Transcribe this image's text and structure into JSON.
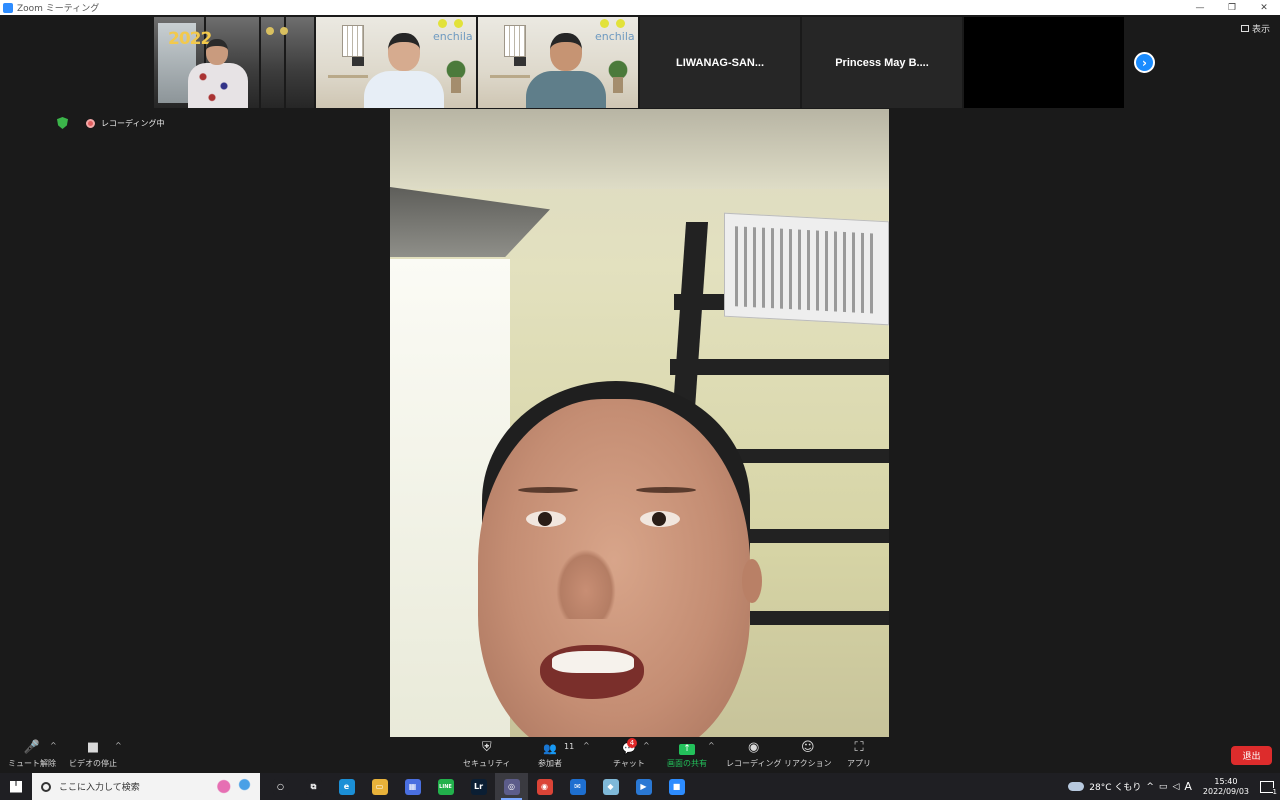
{
  "window": {
    "title": "Zoom ミーティング",
    "controls": [
      "—",
      "❐",
      "✕"
    ]
  },
  "filmstrip": {
    "tiles": [
      {
        "kind": "video",
        "overlay_text": "2022"
      },
      {
        "kind": "video",
        "overlay_text": "enchila"
      },
      {
        "kind": "video",
        "overlay_text": "enchila"
      },
      {
        "kind": "name",
        "name": "LIWANAG-SAN..."
      },
      {
        "kind": "name",
        "name": "Princess  May  B...."
      },
      {
        "kind": "blank"
      }
    ],
    "next_icon": "›"
  },
  "view_toggle": {
    "label": "表示",
    "icon": "grid-icon"
  },
  "recording": {
    "label": "レコーディング中",
    "encryption_icon": "shield-icon"
  },
  "toolbar": {
    "mute": {
      "label": "ミュート解除",
      "icon": "🎤"
    },
    "video": {
      "label": "ビデオの停止",
      "icon": "■"
    },
    "security": {
      "label": "セキュリティ",
      "icon": "⛨"
    },
    "participants": {
      "label": "参加者",
      "count": "11",
      "icon": "👥"
    },
    "chat": {
      "label": "チャット",
      "badge": "4",
      "icon": "💬"
    },
    "share": {
      "label": "画面の共有",
      "icon": "↑"
    },
    "record": {
      "label": "レコーディング",
      "icon": "◉"
    },
    "reactions": {
      "label": "リアクション",
      "icon": "☺"
    },
    "apps": {
      "label": "アプリ",
      "icon": "⛶"
    },
    "caret": "^",
    "leave": {
      "label": "退出"
    }
  },
  "colors": {
    "accent_blue": "#1a8cff",
    "share_green": "#23c15b",
    "leave_red": "#dd2c2c",
    "recording_shield": "#3bb54a"
  },
  "taskbar": {
    "search_placeholder": "ここに入力して検索",
    "apps": [
      {
        "name": "cortana-icon",
        "glyph": "○",
        "color": "#1f1f23"
      },
      {
        "name": "task-view-icon",
        "glyph": "⧉",
        "color": "#1f1f23"
      },
      {
        "name": "edge-icon",
        "glyph": "e",
        "color": "#1b8fd6"
      },
      {
        "name": "file-explorer-icon",
        "glyph": "▭",
        "color": "#e8b23a"
      },
      {
        "name": "store-icon",
        "glyph": "▦",
        "color": "#4a6fe0"
      },
      {
        "name": "line-icon",
        "glyph": "LINE",
        "color": "#22b14c"
      },
      {
        "name": "lightroom-icon",
        "glyph": "Lr",
        "color": "#0b1e33"
      },
      {
        "name": "obs-icon",
        "glyph": "◎",
        "color": "#5c5c8a"
      },
      {
        "name": "chrome-icon",
        "glyph": "◉",
        "color": "#db4437"
      },
      {
        "name": "mail-icon",
        "glyph": "✉",
        "color": "#1e6fd0"
      },
      {
        "name": "notes-icon",
        "glyph": "◆",
        "color": "#7fb9d9"
      },
      {
        "name": "video-editor-icon",
        "glyph": "▶",
        "color": "#2a78d4"
      },
      {
        "name": "zoom-icon",
        "glyph": "■",
        "color": "#2d8cff"
      }
    ],
    "weather": "28°C  くもり",
    "ime": "A",
    "time": "15:40",
    "date": "2022/09/03",
    "notification_count": "1"
  }
}
